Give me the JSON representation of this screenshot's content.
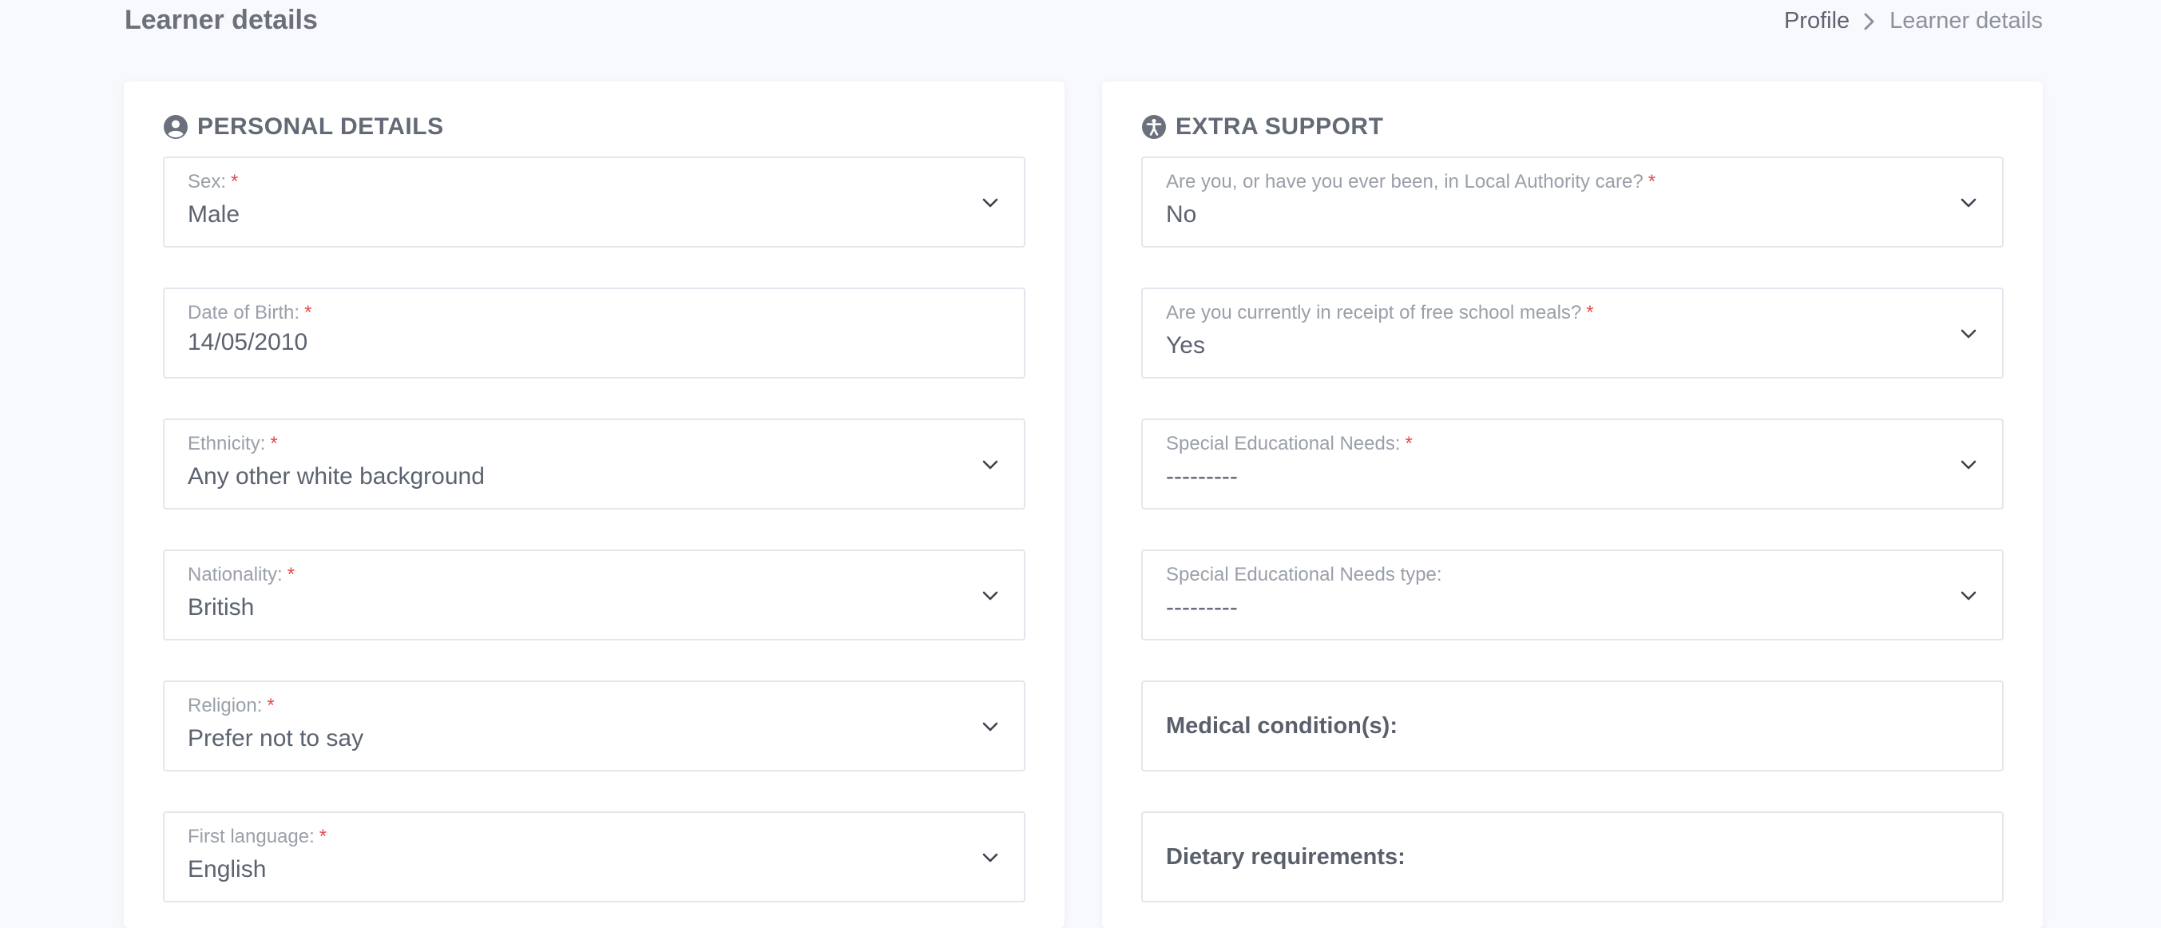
{
  "header": {
    "title": "Learner details",
    "breadcrumb": {
      "link": "Profile",
      "current": "Learner details"
    }
  },
  "personal": {
    "title": "PERSONAL DETAILS",
    "icon": "user-circle-icon",
    "fields": {
      "sex": {
        "label": "Sex:",
        "value": "Male"
      },
      "dob": {
        "label": "Date of Birth:",
        "value": "14/05/2010"
      },
      "ethnicity": {
        "label": "Ethnicity:",
        "value": "Any other white background"
      },
      "nationality": {
        "label": "Nationality:",
        "value": "British"
      },
      "religion": {
        "label": "Religion:",
        "value": "Prefer not to say"
      },
      "language": {
        "label": "First language:",
        "value": "English"
      }
    }
  },
  "support": {
    "title": "EXTRA SUPPORT",
    "icon": "accessibility-icon",
    "fields": {
      "la_care": {
        "label": "Are you, or have you ever been, in Local Authority care?",
        "value": "No"
      },
      "fsm": {
        "label": "Are you currently in receipt of free school meals?",
        "value": "Yes"
      },
      "sen": {
        "label": "Special Educational Needs:",
        "value": "---------"
      },
      "sen_type": {
        "label": "Special Educational Needs type:",
        "value": "---------"
      },
      "medical": {
        "label": "Medical condition(s):"
      },
      "dietary": {
        "label": "Dietary requirements:"
      }
    }
  },
  "required_marker": "*",
  "colors": {
    "background": "#f8f9fd",
    "card": "#ffffff",
    "border": "#e3e6ec",
    "required": "#e24c4c",
    "label": "#9aa0a9",
    "text": "#5c6370"
  }
}
